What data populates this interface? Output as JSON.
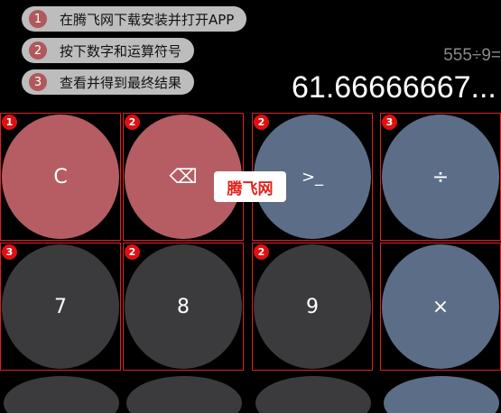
{
  "steps": [
    {
      "num": "1",
      "text": "在腾飞网下载安装并打开APP"
    },
    {
      "num": "2",
      "text": "按下数字和运算符号"
    },
    {
      "num": "3",
      "text": "查看并得到最终结果"
    }
  ],
  "display": {
    "expression": "555÷9=",
    "result": "61.66666667..."
  },
  "watermark": "腾飞网",
  "keys": {
    "row1": [
      {
        "label": "C",
        "badge": "1",
        "color": "#b55d63"
      },
      {
        "label": "⌫",
        "badge": "2",
        "color": "#b55d63"
      },
      {
        "label": ">_",
        "badge": "2",
        "color": "#5c6d87"
      },
      {
        "label": "÷",
        "badge": "3",
        "color": "#5c6d87"
      }
    ],
    "row2": [
      {
        "label": "7",
        "badge": "3",
        "color": "#3b3b3d"
      },
      {
        "label": "8",
        "badge": "2",
        "color": "#3b3b3d"
      },
      {
        "label": "9",
        "badge": "2",
        "color": "#3b3b3d"
      },
      {
        "label": "×",
        "badge": "",
        "color": "#5c6d87"
      }
    ]
  }
}
